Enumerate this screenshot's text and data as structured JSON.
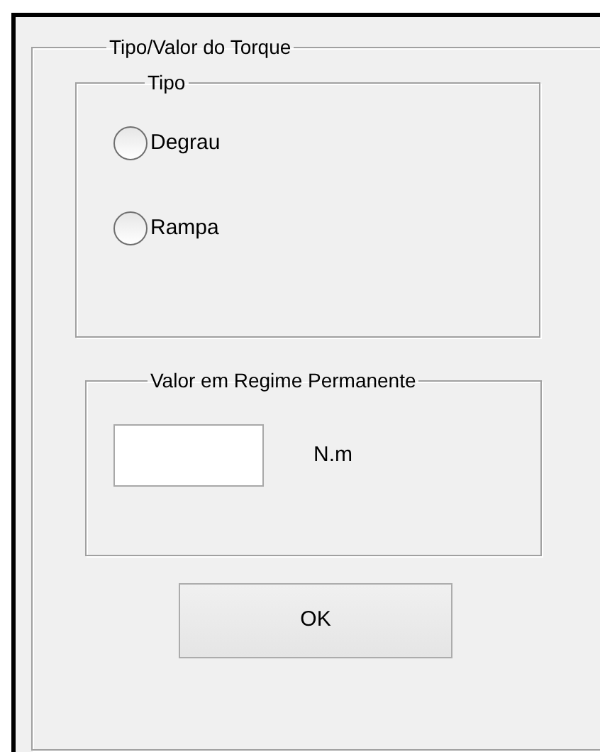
{
  "panel": {
    "title": "Tipo/Valor do Torque"
  },
  "type_group": {
    "title": "Tipo",
    "options": [
      {
        "label": "Degrau",
        "selected": false
      },
      {
        "label": "Rampa",
        "selected": false
      }
    ]
  },
  "value_group": {
    "title": "Valor em Regime Permanente",
    "unit": "N.m"
  },
  "button": {
    "label": "OK"
  }
}
